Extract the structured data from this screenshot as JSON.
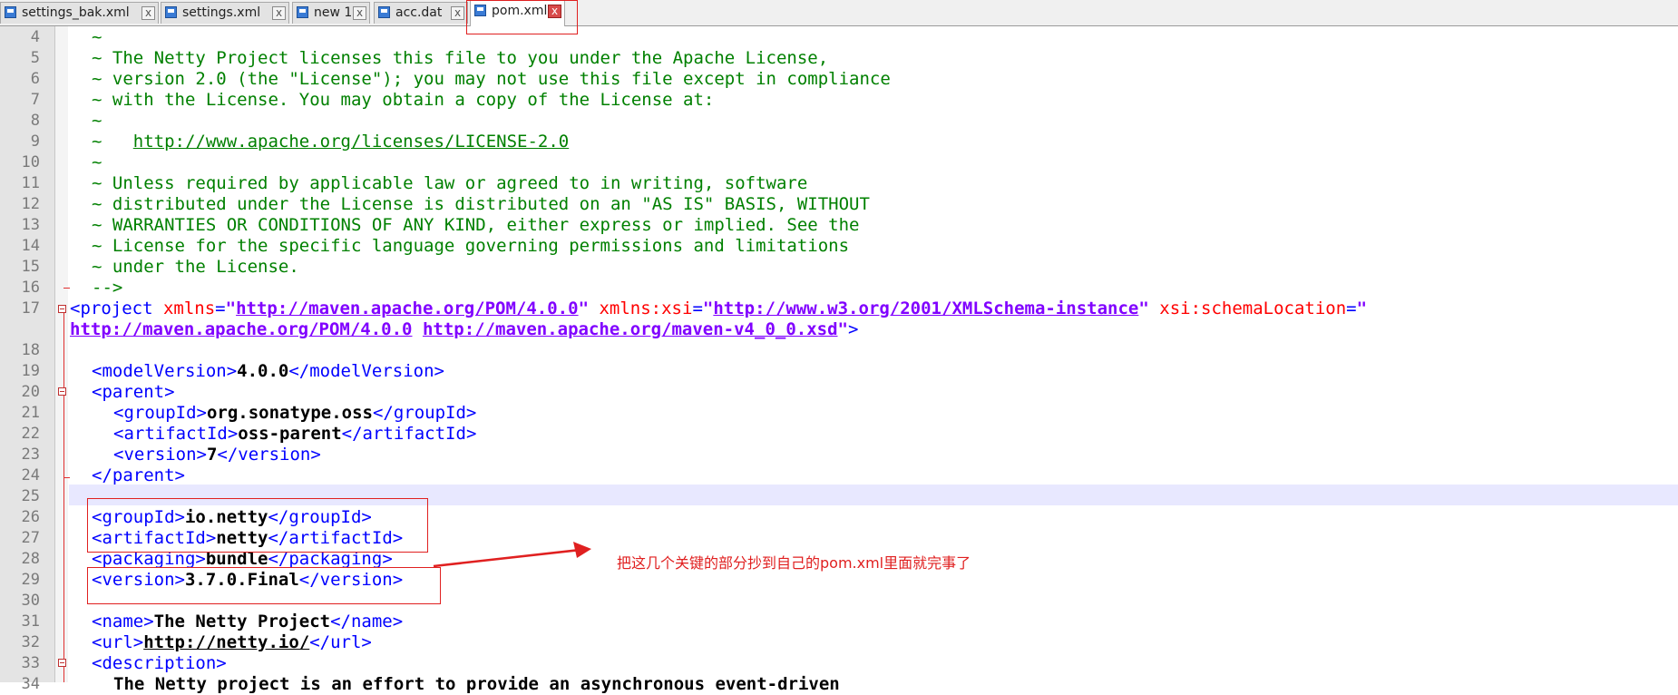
{
  "tabs": [
    {
      "label": "settings_bak.xml",
      "close": "x"
    },
    {
      "label": "settings.xml",
      "close": "x"
    },
    {
      "label": "new 1",
      "close": "x"
    },
    {
      "label": "acc.dat",
      "close": "x"
    },
    {
      "label": "pom.xml",
      "close": "x",
      "active": true
    }
  ],
  "editor": {
    "line_numbers": [
      "4",
      "5",
      "6",
      "7",
      "8",
      "9",
      "10",
      "11",
      "12",
      "13",
      "14",
      "15",
      "16",
      "17",
      "18",
      "19",
      "20",
      "21",
      "22",
      "23",
      "24",
      "25",
      "26",
      "27",
      "28",
      "29",
      "30",
      "31",
      "32",
      "33",
      "34"
    ],
    "comment": {
      "l4": "~",
      "l5": "~ The Netty Project licenses this file to you under the Apache License,",
      "l6": "~ version 2.0 (the \"License\"); you may not use this file except in compliance",
      "l7": "~ with the License. You may obtain a copy of the License at:",
      "l8": "~",
      "l9_prefix": "~   ",
      "l9_link": "http://www.apache.org/licenses/LICENSE-2.0",
      "l10": "~",
      "l11": "~ Unless required by applicable law or agreed to in writing, software",
      "l12": "~ distributed under the License is distributed on an \"AS IS\" BASIS, WITHOUT",
      "l13": "~ WARRANTIES OR CONDITIONS OF ANY KIND, either express or implied. See the",
      "l14": "~ License for the specific language governing permissions and limitations",
      "l15": "~ under the License.",
      "l16": "-->"
    },
    "project": {
      "open": "<project",
      "attr_xmlns": "xmlns",
      "ns_pom": "http://maven.apache.org/POM/4.0.0",
      "attr_xsi": "xmlns:xsi",
      "ns_xsi": "http://www.w3.org/2001/XMLSchema-instance",
      "attr_schema": "xsi:schemaLocation",
      "schema_1": "http://maven.apache.org/POM/4.0.0",
      "schema_2": "http://maven.apache.org/maven-v4_0_0.xsd",
      "eq": "=",
      "quote": "\"",
      "close": ">"
    },
    "model_version": {
      "open": "<modelVersion>",
      "value": "4.0.0",
      "close": "</modelVersion>"
    },
    "parent": {
      "open": "<parent>",
      "close": "</parent>",
      "group_id": {
        "open": "<groupId>",
        "value": "org.sonatype.oss",
        "close": "</groupId>"
      },
      "artifact_id": {
        "open": "<artifactId>",
        "value": "oss-parent",
        "close": "</artifactId>"
      },
      "version": {
        "open": "<version>",
        "value": "7",
        "close": "</version>"
      }
    },
    "group_id": {
      "open": "<groupId>",
      "value": "io.netty",
      "close": "</groupId>"
    },
    "artifact_id": {
      "open": "<artifactId>",
      "value": "netty",
      "close": "</artifactId>"
    },
    "packaging": {
      "open": "<packaging>",
      "value": "bundle",
      "close": "</packaging>"
    },
    "version": {
      "open": "<version>",
      "value": "3.7.0.Final",
      "close": "</version>"
    },
    "name": {
      "open": "<name>",
      "value": "The Netty Project",
      "close": "</name>"
    },
    "url": {
      "open": "<url>",
      "value": "http://netty.io/",
      "close": "</url>"
    },
    "description": {
      "open": "<description>"
    },
    "line34_partial": "The Netty project is an effort to provide an asynchronous event-driven"
  },
  "annotation": {
    "text": "把这几个关键的部分抄到自己的pom.xml里面就完事了",
    "color": "#e02020"
  },
  "colors": {
    "comment": "#008000",
    "tag": "#0000ff",
    "attr": "#ff0000",
    "attr_value": "#8000ff",
    "current_line": "#e8e8ff",
    "highlight_box": "#e02020"
  }
}
